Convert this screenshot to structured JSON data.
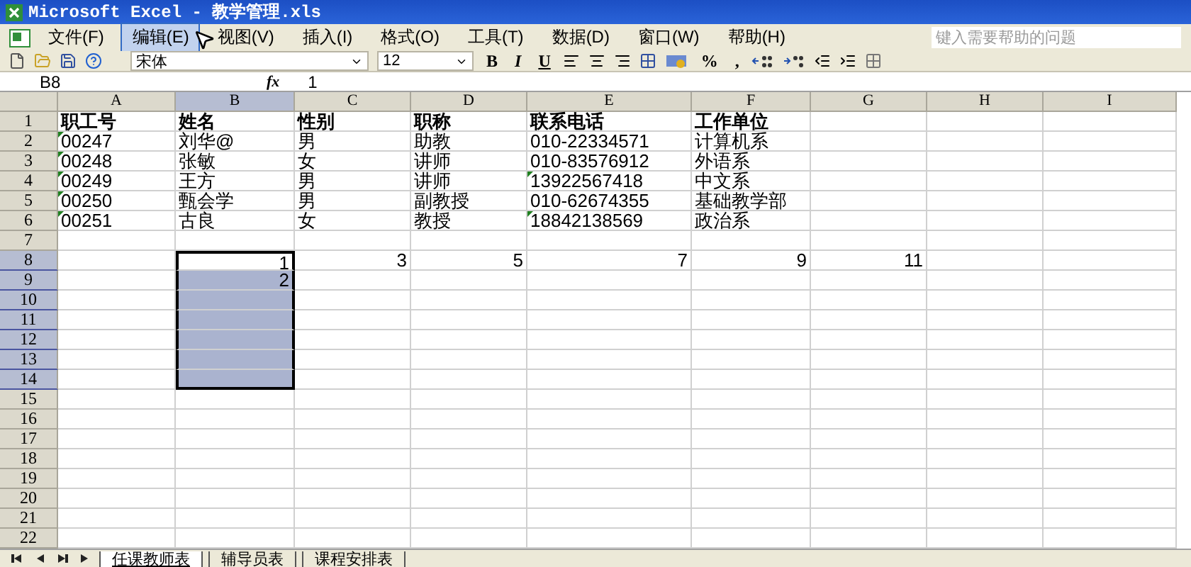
{
  "window": {
    "title": "Microsoft Excel - 教学管理.xls"
  },
  "menu": [
    {
      "label": "文件(F)",
      "selected": false
    },
    {
      "label": "编辑(E)",
      "selected": true
    },
    {
      "label": "视图(V)",
      "selected": false
    },
    {
      "label": "插入(I)",
      "selected": false
    },
    {
      "label": "格式(O)",
      "selected": false
    },
    {
      "label": "工具(T)",
      "selected": false
    },
    {
      "label": "数据(D)",
      "selected": false
    },
    {
      "label": "窗口(W)",
      "selected": false
    },
    {
      "label": "帮助(H)",
      "selected": false
    }
  ],
  "help_search": {
    "placeholder": "键入需要帮助的问题"
  },
  "toolbar": {
    "font": "宋体",
    "size": "12",
    "format_buttons": [
      "B",
      "I",
      "U"
    ],
    "number_buttons": [
      "%",
      ","
    ]
  },
  "formula_bar": {
    "name_box": "B8",
    "function_button": "fx",
    "value": "1"
  },
  "columns": [
    {
      "label": "A",
      "selected": false
    },
    {
      "label": "B",
      "selected": true
    },
    {
      "label": "C",
      "selected": false
    },
    {
      "label": "D",
      "selected": false
    },
    {
      "label": "E",
      "selected": false
    },
    {
      "label": "F",
      "selected": false
    },
    {
      "label": "G",
      "selected": false
    },
    {
      "label": "H",
      "selected": false
    },
    {
      "label": "I",
      "selected": false
    }
  ],
  "rows": [
    {
      "label": "1",
      "selected": false,
      "kind": "header",
      "cells": [
        {
          "text": "职工号"
        },
        {
          "text": "姓名"
        },
        {
          "text": "性别"
        },
        {
          "text": "职称"
        },
        {
          "text": "联系电话"
        },
        {
          "text": "工作单位"
        },
        {},
        {},
        {}
      ]
    },
    {
      "label": "2",
      "selected": false,
      "kind": "text",
      "cells": [
        {
          "text": "00247",
          "flag": true
        },
        {
          "text": "刘华@"
        },
        {
          "text": "男"
        },
        {
          "text": "助教"
        },
        {
          "text": "010-22334571"
        },
        {
          "text": "计算机系"
        },
        {},
        {},
        {}
      ]
    },
    {
      "label": "3",
      "selected": false,
      "kind": "text",
      "cells": [
        {
          "text": "00248",
          "flag": true
        },
        {
          "text": "张敏"
        },
        {
          "text": "女"
        },
        {
          "text": "讲师"
        },
        {
          "text": "010-83576912"
        },
        {
          "text": "外语系"
        },
        {},
        {},
        {}
      ]
    },
    {
      "label": "4",
      "selected": false,
      "kind": "text",
      "cells": [
        {
          "text": "00249",
          "flag": true
        },
        {
          "text": "王方"
        },
        {
          "text": "男"
        },
        {
          "text": "讲师"
        },
        {
          "text": "13922567418",
          "flag": true
        },
        {
          "text": "中文系"
        },
        {},
        {},
        {}
      ]
    },
    {
      "label": "5",
      "selected": false,
      "kind": "text",
      "cells": [
        {
          "text": "00250",
          "flag": true
        },
        {
          "text": "甄会学"
        },
        {
          "text": "男"
        },
        {
          "text": "副教授"
        },
        {
          "text": "010-62674355"
        },
        {
          "text": "基础教学部"
        },
        {},
        {},
        {}
      ]
    },
    {
      "label": "6",
      "selected": false,
      "kind": "text",
      "cells": [
        {
          "text": "00251",
          "flag": true
        },
        {
          "text": "古良"
        },
        {
          "text": "女"
        },
        {
          "text": "教授"
        },
        {
          "text": "18842138569",
          "flag": true
        },
        {
          "text": "政治系"
        },
        {},
        {},
        {}
      ]
    },
    {
      "label": "7",
      "selected": false,
      "kind": "text",
      "cells": [
        {},
        {},
        {},
        {},
        {},
        {},
        {},
        {},
        {}
      ]
    },
    {
      "label": "8",
      "selected": true,
      "kind": "number",
      "cells": [
        {},
        {
          "text": "1",
          "active": true
        },
        {
          "text": "3"
        },
        {
          "text": "5"
        },
        {
          "text": "7"
        },
        {
          "text": "9"
        },
        {
          "text": "11"
        },
        {},
        {}
      ]
    },
    {
      "label": "9",
      "selected": true,
      "kind": "number",
      "cells": [
        {},
        {
          "text": "2",
          "selected": true
        },
        {},
        {},
        {},
        {},
        {},
        {},
        {}
      ]
    },
    {
      "label": "10",
      "selected": true,
      "kind": "number",
      "cells": [
        {},
        {
          "selected": true
        },
        {},
        {},
        {},
        {},
        {},
        {},
        {}
      ]
    },
    {
      "label": "11",
      "selected": true,
      "kind": "number",
      "cells": [
        {},
        {
          "selected": true
        },
        {},
        {},
        {},
        {},
        {},
        {},
        {}
      ]
    },
    {
      "label": "12",
      "selected": true,
      "kind": "number",
      "cells": [
        {},
        {
          "selected": true
        },
        {},
        {},
        {},
        {},
        {},
        {},
        {}
      ]
    },
    {
      "label": "13",
      "selected": true,
      "kind": "number",
      "cells": [
        {},
        {
          "selected": true
        },
        {},
        {},
        {},
        {},
        {},
        {},
        {}
      ]
    },
    {
      "label": "14",
      "selected": true,
      "kind": "number",
      "cells": [
        {},
        {
          "selected": true
        },
        {},
        {},
        {},
        {},
        {},
        {},
        {}
      ]
    },
    {
      "label": "15",
      "selected": false,
      "kind": "text",
      "cells": [
        {},
        {},
        {},
        {},
        {},
        {},
        {},
        {},
        {}
      ]
    },
    {
      "label": "16",
      "selected": false,
      "kind": "text",
      "cells": [
        {},
        {},
        {},
        {},
        {},
        {},
        {},
        {},
        {}
      ]
    },
    {
      "label": "17",
      "selected": false,
      "kind": "text",
      "cells": [
        {},
        {},
        {},
        {},
        {},
        {},
        {},
        {},
        {}
      ]
    },
    {
      "label": "18",
      "selected": false,
      "kind": "text",
      "cells": [
        {},
        {},
        {},
        {},
        {},
        {},
        {},
        {},
        {}
      ]
    },
    {
      "label": "19",
      "selected": false,
      "kind": "text",
      "cells": [
        {},
        {},
        {},
        {},
        {},
        {},
        {},
        {},
        {}
      ]
    },
    {
      "label": "20",
      "selected": false,
      "kind": "text",
      "cells": [
        {},
        {},
        {},
        {},
        {},
        {},
        {},
        {},
        {}
      ]
    },
    {
      "label": "21",
      "selected": false,
      "kind": "text",
      "cells": [
        {},
        {},
        {},
        {},
        {},
        {},
        {},
        {},
        {}
      ]
    },
    {
      "label": "22",
      "selected": false,
      "kind": "text",
      "cells": [
        {},
        {},
        {},
        {},
        {},
        {},
        {},
        {},
        {}
      ]
    }
  ],
  "sheet_tabs": [
    {
      "label": "任课教师表",
      "selected": true
    },
    {
      "label": "辅导员表",
      "selected": false
    },
    {
      "label": "课程安排表",
      "selected": false
    }
  ]
}
